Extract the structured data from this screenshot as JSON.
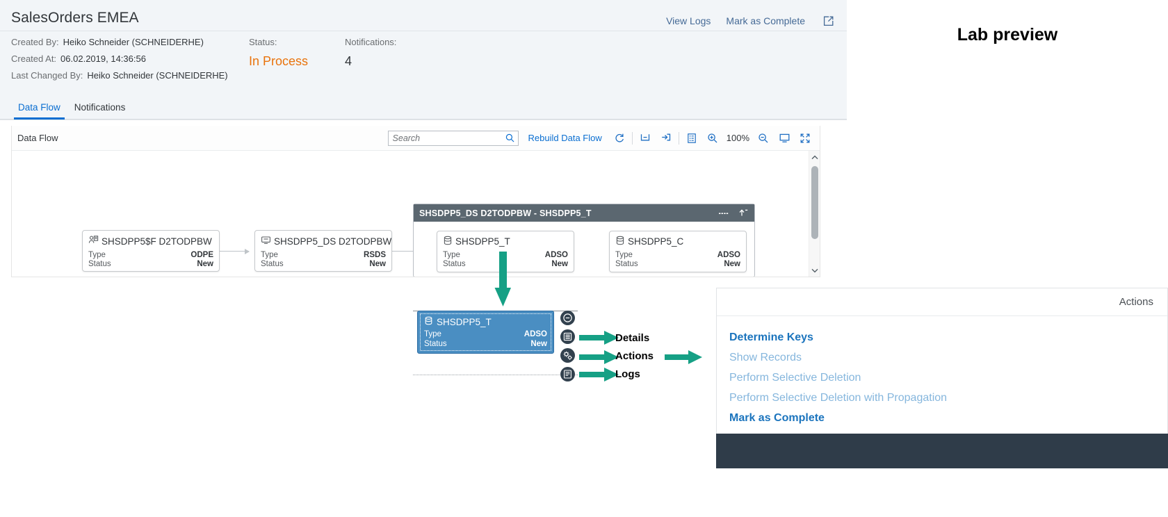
{
  "header": {
    "title": "SalesOrders EMEA",
    "actions": [
      {
        "label": "View Logs",
        "name": "view-logs-link"
      },
      {
        "label": "Mark as Complete",
        "name": "mark-as-complete-link"
      }
    ],
    "export_icon": "external-link-icon",
    "meta": {
      "created_by_label": "Created By:",
      "created_by_value": "Heiko Schneider (SCHNEIDERHE)",
      "created_at_label": "Created At:",
      "created_at_value": "06.02.2019, 14:36:56",
      "last_changed_by_label": "Last Changed By:",
      "last_changed_by_value": "Heiko Schneider (SCHNEIDERHE)",
      "status_label": "Status:",
      "status_value": "In Process",
      "status_color": "#e9730c",
      "notifications_label": "Notifications:",
      "notifications_value": "4"
    }
  },
  "tabs": [
    {
      "label": "Data Flow",
      "active": true
    },
    {
      "label": "Notifications",
      "active": false
    }
  ],
  "dataflow_card": {
    "toolbar_title": "Data Flow",
    "search": {
      "placeholder": "Search",
      "value": "",
      "icon": "search-icon"
    },
    "rebuild_label": "Rebuild Data Flow",
    "zoom_level": "100%",
    "buttons": [
      {
        "name": "refresh-icon",
        "title": "Refresh"
      },
      {
        "name": "collapse-all-icon",
        "title": "Collapse All"
      },
      {
        "name": "expand-all-icon",
        "title": "Expand All"
      },
      {
        "name": "legend-icon",
        "title": "Legend"
      },
      {
        "name": "zoom-in-icon",
        "title": "Zoom In"
      },
      {
        "name": "zoom-out-icon",
        "title": "Zoom Out"
      },
      {
        "name": "fit-to-screen-icon",
        "title": "Fit to Screen"
      },
      {
        "name": "full-screen-icon",
        "title": "Full Screen"
      }
    ]
  },
  "graph": {
    "nodes": [
      {
        "id": "n1",
        "title": "SHSDPP5$F D2TODPBW",
        "icon": "datasource-contact-icon",
        "type_label": "Type",
        "type_value": "ODPE",
        "status_label": "Status",
        "status_value": "New"
      },
      {
        "id": "n2",
        "title": "SHSDPP5_DS D2TODPBW",
        "icon": "datasource-icon",
        "type_label": "Type",
        "type_value": "RSDS",
        "status_label": "Status",
        "status_value": "New"
      },
      {
        "id": "n3",
        "title": "SHSDPP5_T",
        "icon": "database-icon",
        "type_label": "Type",
        "type_value": "ADSO",
        "status_label": "Status",
        "status_value": "New"
      },
      {
        "id": "n4",
        "title": "SHSDPP5_C",
        "icon": "database-icon",
        "type_label": "Type",
        "type_value": "ADSO",
        "status_label": "Status",
        "status_value": "New"
      }
    ],
    "group": {
      "title": "SHSDPP5_DS D2TODPBW - SHSDPP5_T",
      "more_icon": "more-options-icon",
      "collapse_icon": "collapse-up-icon"
    }
  },
  "selected_node": {
    "title": "SHSDPP5_T",
    "icon": "database-icon",
    "type_label": "Type",
    "type_value": "ADSO",
    "status_label": "Status",
    "status_value": "New",
    "buttons": [
      {
        "name": "collapse-node-icon"
      },
      {
        "name": "details-list-icon"
      },
      {
        "name": "actions-gear-icon"
      },
      {
        "name": "logs-icon"
      }
    ]
  },
  "annotations": [
    {
      "label": "Details",
      "name": "annotation-details"
    },
    {
      "label": "Actions",
      "name": "annotation-actions"
    },
    {
      "label": "Logs",
      "name": "annotation-logs"
    }
  ],
  "right_panel": {
    "lab_preview": "Lab preview",
    "actions_title": "Actions",
    "items": [
      {
        "label": "Determine Keys",
        "style": "strong"
      },
      {
        "label": "Show Records",
        "style": "muted"
      },
      {
        "label": "Perform Selective Deletion",
        "style": "muted"
      },
      {
        "label": "Perform Selective Deletion with Propagation",
        "style": "muted"
      },
      {
        "label": "Mark as Complete",
        "style": "strong"
      }
    ]
  },
  "colors": {
    "accent_blue": "#0a6ed1",
    "status_orange": "#e9730c",
    "annotation_green": "#16a085",
    "selected_node_blue": "#4a8ec2",
    "group_header": "#5b6770",
    "dark_bar": "#2f3c49"
  }
}
